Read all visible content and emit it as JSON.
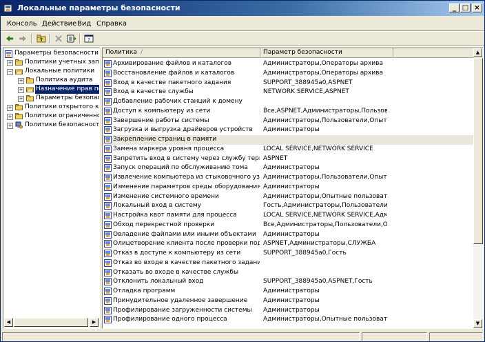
{
  "window": {
    "title": "Локальные параметры безопасности",
    "buttons": {
      "minimize": "_",
      "maximize": "□",
      "close": "×"
    }
  },
  "menu": {
    "items": [
      {
        "label": "Консоль"
      },
      {
        "label": "Действие"
      },
      {
        "label": "Вид"
      },
      {
        "label": "Справка"
      }
    ]
  },
  "toolbar": {
    "icons": [
      "arrow-left-icon",
      "arrow-right-icon",
      "up-folder-icon",
      "delete-icon",
      "export-list-icon",
      "help-icon"
    ]
  },
  "tree": {
    "items": [
      {
        "label": "Параметры безопасности",
        "level": 0,
        "expander": "",
        "icon": "security-settings-icon"
      },
      {
        "label": "Политики учетных запи...",
        "level": 1,
        "expander": "+",
        "icon": "folder-icon"
      },
      {
        "label": "Локальные политики",
        "level": 1,
        "expander": "−",
        "icon": "folder-open-icon"
      },
      {
        "label": "Политика аудита",
        "level": 2,
        "expander": "+",
        "icon": "folder-icon"
      },
      {
        "label": "Назначение прав пол...",
        "level": 2,
        "expander": "+",
        "icon": "folder-open-icon",
        "selected": true
      },
      {
        "label": "Параметры безопасн...",
        "level": 2,
        "expander": "+",
        "icon": "folder-icon"
      },
      {
        "label": "Политики открытого клю...",
        "level": 1,
        "expander": "+",
        "icon": "folder-icon"
      },
      {
        "label": "Политики ограниченного...",
        "level": 1,
        "expander": "+",
        "icon": "folder-icon"
      },
      {
        "label": "Политики безопасности I...",
        "level": 1,
        "expander": "+",
        "icon": "ip-security-icon"
      }
    ]
  },
  "list": {
    "columns": [
      {
        "label": "Политика"
      },
      {
        "label": "Параметр безопасности"
      }
    ],
    "sort_indicator": "/",
    "rows": [
      {
        "policy": "Архивирование файлов и каталогов",
        "value": "Администраторы,Операторы архива"
      },
      {
        "policy": "Восстановление файлов и каталогов",
        "value": "Администраторы,Операторы архива"
      },
      {
        "policy": "Вход в качестве пакетного задания",
        "value": "SUPPORT_388945a0,ASPNET"
      },
      {
        "policy": "Вход в качестве службы",
        "value": "NETWORK SERVICE,ASPNET"
      },
      {
        "policy": "Добавление рабочих станций к домену",
        "value": ""
      },
      {
        "policy": "Доступ к компьютеру из сети",
        "value": "Все,ASPNET,Администраторы,Пользоват..."
      },
      {
        "policy": "Завершение работы системы",
        "value": "Администраторы,Пользователи,Опытны..."
      },
      {
        "policy": "Загрузка и выгрузка драйверов устройств",
        "value": "Администраторы"
      },
      {
        "policy": "Закрепление страниц в памяти",
        "value": "",
        "highlight": true
      },
      {
        "policy": "Замена маркера уровня процесса",
        "value": "LOCAL SERVICE,NETWORK SERVICE"
      },
      {
        "policy": "Запретить вход в систему через службу термин...",
        "value": "ASPNET"
      },
      {
        "policy": "Запуск операций по обслуживанию тома",
        "value": "Администраторы"
      },
      {
        "policy": "Извлечение компьютера из стыковочного узла",
        "value": "Администраторы,Пользователи,Опытны..."
      },
      {
        "policy": "Изменение параметров среды оборудования",
        "value": "Администраторы"
      },
      {
        "policy": "Изменение системного времени",
        "value": "Администраторы,Опытные пользователи"
      },
      {
        "policy": "Локальный вход в систему",
        "value": "Гость,Администраторы,Пользователи,О..."
      },
      {
        "policy": "Настройка квот памяти для процесса",
        "value": "LOCAL SERVICE,NETWORK SERVICE,Админ..."
      },
      {
        "policy": "Обход перекрестной проверки",
        "value": "Все,Администраторы,Пользователи,Опы..."
      },
      {
        "policy": "Овладение файлами или иными объектами",
        "value": "Администраторы"
      },
      {
        "policy": "Олицетворение клиента после проверки подли...",
        "value": "ASPNET,Администраторы,СЛУЖБА"
      },
      {
        "policy": "Отказ в доступе к компьютеру из сети",
        "value": "SUPPORT_388945a0,Гость"
      },
      {
        "policy": "Отказ во входе в качестве пакетного задания",
        "value": ""
      },
      {
        "policy": "Отказать во входе в качестве службы",
        "value": ""
      },
      {
        "policy": "Отклонить локальный вход",
        "value": "SUPPORT_388945a0,ASPNET,Гость"
      },
      {
        "policy": "Отладка программ",
        "value": "Администраторы"
      },
      {
        "policy": "Принудительное удаленное завершение",
        "value": "Администраторы"
      },
      {
        "policy": "Профилирование загруженности системы",
        "value": "Администраторы"
      },
      {
        "policy": "Профилирование одного процесса",
        "value": "Администраторы,Опытные пользователи"
      }
    ]
  },
  "colors": {
    "title_start": "#0a246a",
    "title_end": "#a6caf0",
    "selection": "#0a246a",
    "chrome": "#ece9d8"
  }
}
